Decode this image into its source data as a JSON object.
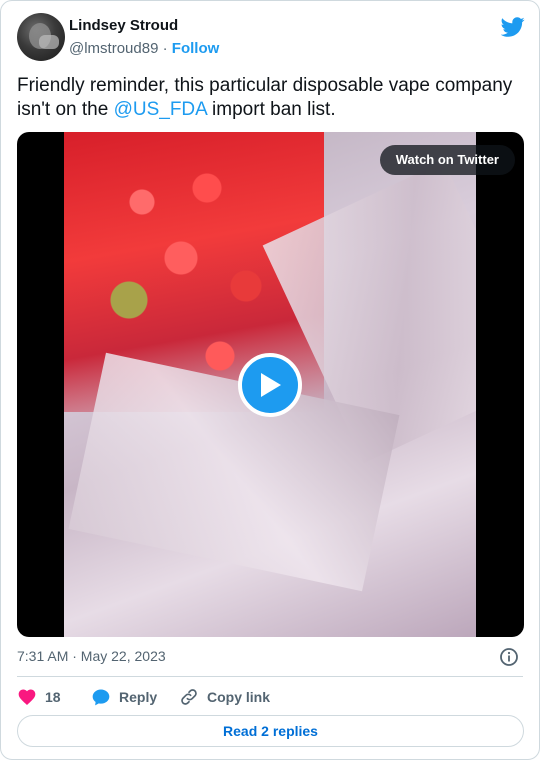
{
  "author": {
    "name": "Lindsey Stroud",
    "handle": "@lmstroud89",
    "follow_label": "Follow"
  },
  "tweet": {
    "text_before": "Friendly reminder, this particular disposable vape company isn't on the ",
    "mention": "@US_FDA",
    "text_after": " import ban list."
  },
  "media": {
    "watch_label": "Watch on Twitter"
  },
  "timestamp": "7:31 AM · May 22, 2023",
  "actions": {
    "like_count": "18",
    "reply_label": "Reply",
    "copy_label": "Copy link"
  },
  "read_replies_label": "Read 2 replies",
  "colors": {
    "accent": "#1d9bf0",
    "like": "#f91880",
    "link": "#006fd6"
  },
  "icons": [
    "twitter-bird-icon",
    "play-icon",
    "info-icon",
    "heart-icon",
    "reply-bubble-icon",
    "link-icon"
  ]
}
